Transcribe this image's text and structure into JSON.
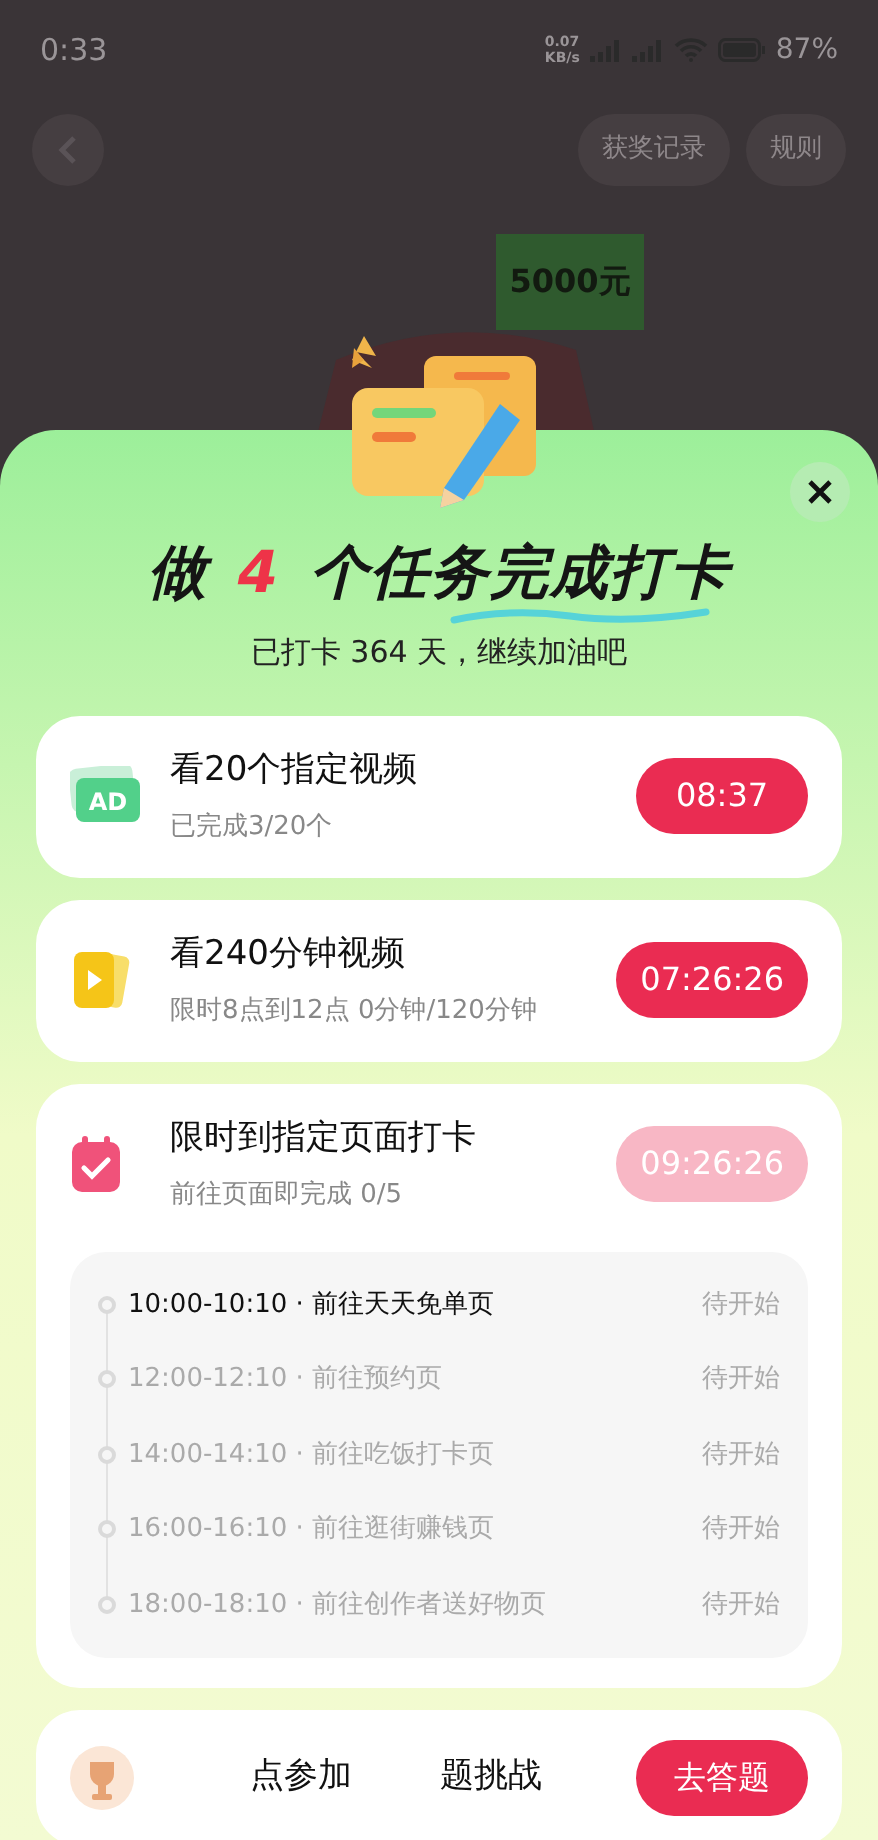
{
  "status_bar": {
    "time": "0:33",
    "speed": "0.07\nKB/s",
    "battery": "87%"
  },
  "background": {
    "buttons": [
      "获奖记录",
      "规则"
    ],
    "prize": "5000元"
  },
  "sheet": {
    "title_parts": [
      "做",
      "4",
      "个任务完成打卡"
    ],
    "subtitle": "已打卡 364 天，继续加油吧",
    "tasks": [
      {
        "kind": "ad",
        "badge": "AD",
        "title": "看20个指定视频",
        "detail": "已完成3/20个",
        "button": "08:37",
        "disabled": false
      },
      {
        "kind": "video",
        "title": "看240分钟视频",
        "detail": "限时8点到12点 0分钟/120分钟",
        "button": "07:26:26",
        "disabled": false
      },
      {
        "kind": "checkin",
        "title": "限时到指定页面打卡",
        "detail": "前往页面即完成 0/5",
        "button": "09:26:26",
        "disabled": true,
        "separator": "·",
        "slots": [
          {
            "time": "10:00-10:10",
            "label": "前往天天免单页",
            "status": "待开始",
            "active": true
          },
          {
            "time": "12:00-12:10",
            "label": "前往预约页",
            "status": "待开始",
            "active": false
          },
          {
            "time": "14:00-14:10",
            "label": "前往吃饭打卡页",
            "status": "待开始",
            "active": false
          },
          {
            "time": "16:00-16:10",
            "label": "前往逛街赚钱页",
            "status": "待开始",
            "active": false
          },
          {
            "time": "18:00-18:10",
            "label": "前往创作者送好物页",
            "status": "待开始",
            "active": false
          }
        ]
      },
      {
        "kind": "quiz",
        "title_parts": [
          "点参加",
          "题挑战"
        ],
        "button": "去答题",
        "disabled": false
      }
    ]
  }
}
